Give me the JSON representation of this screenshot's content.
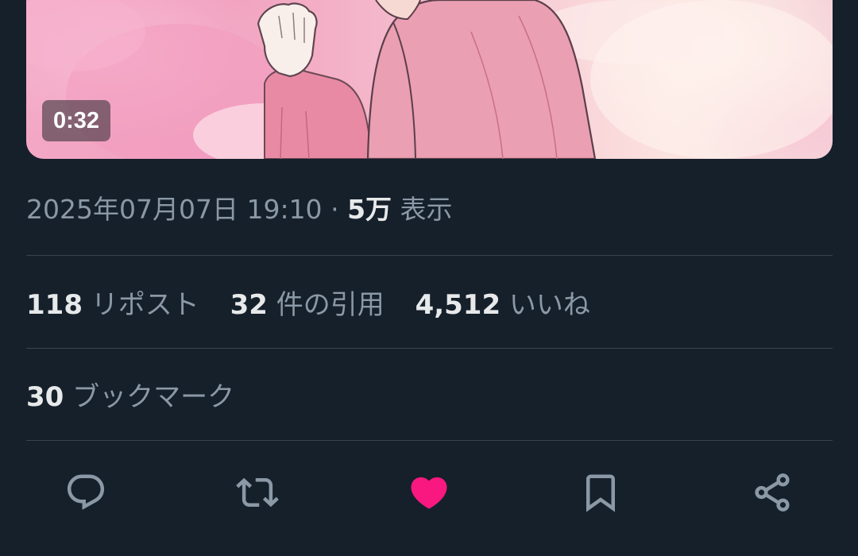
{
  "media": {
    "duration": "0:32"
  },
  "meta": {
    "timestamp": "2025年07月07日 19:10",
    "separator": "·",
    "views_count": "5万",
    "views_label": "表示"
  },
  "stats": {
    "reposts": {
      "count": "118",
      "label": "リポスト"
    },
    "quotes": {
      "count": "32",
      "label": "件の引用"
    },
    "likes": {
      "count": "4,512",
      "label": "いいね"
    },
    "bookmarks": {
      "count": "30",
      "label": "ブックマーク"
    }
  },
  "actions": {
    "reply_icon": "reply-icon",
    "repost_icon": "repost-icon",
    "like_icon": "heart-icon",
    "bookmark_icon": "bookmark-icon",
    "share_icon": "share-icon",
    "like_color": "#f91880",
    "icon_color": "#8b98a5"
  },
  "colors": {
    "background": "#15202b",
    "text_primary": "#e7e9ea",
    "text_secondary": "#8b98a5",
    "divider": "#38444d"
  }
}
